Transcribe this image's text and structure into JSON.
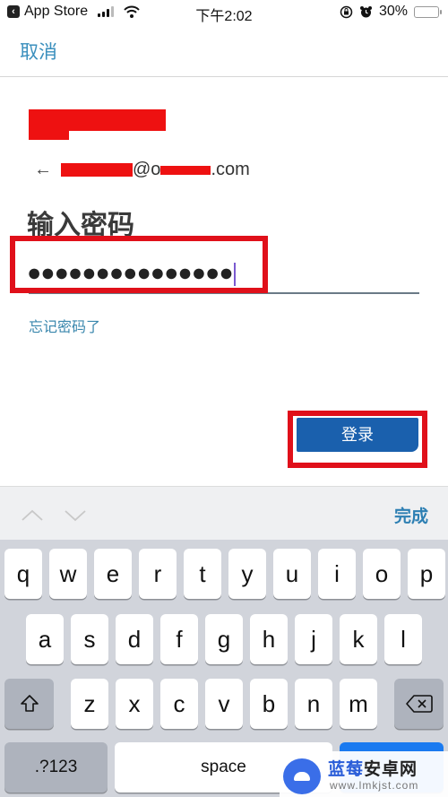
{
  "status_bar": {
    "back_app_label": "App Store",
    "time": "下午2:02",
    "battery_percent_label": "30%",
    "battery_level": 0.3,
    "icons": [
      "back-arrow-icon",
      "signal-icon",
      "wifi-icon",
      "rotation-lock-icon",
      "alarm-icon",
      "battery-icon"
    ]
  },
  "nav": {
    "cancel_label": "取消"
  },
  "account": {
    "back_arrow": "←",
    "email_visible_part_1": "@o",
    "email_visible_part_2": ".com"
  },
  "page": {
    "title": "输入密码",
    "password_masked": "●●●●●●●●●●●●●●●",
    "forgot_password_label": "忘记密码了",
    "login_button_label": "登录"
  },
  "keyboard_toolbar": {
    "prev_icon": "chevron-up-icon",
    "next_icon": "chevron-down-icon",
    "done_label": "完成"
  },
  "keyboard": {
    "row1": [
      "q",
      "w",
      "e",
      "r",
      "t",
      "y",
      "u",
      "i",
      "o",
      "p"
    ],
    "row2": [
      "a",
      "s",
      "d",
      "f",
      "g",
      "h",
      "j",
      "k",
      "l"
    ],
    "row3": [
      "z",
      "x",
      "c",
      "v",
      "b",
      "n",
      "m"
    ],
    "shift_icon": "shift-icon",
    "delete_icon": "backspace-icon",
    "numbers_label": ".?123",
    "space_label": "space"
  },
  "watermark": {
    "title_part1": "蓝莓",
    "title_part2": "安卓网",
    "url": "www.lmkjst.com"
  },
  "colors": {
    "accent_blue": "#3a8fbd",
    "login_button": "#1a60ad",
    "highlight_red": "#e0101a"
  }
}
